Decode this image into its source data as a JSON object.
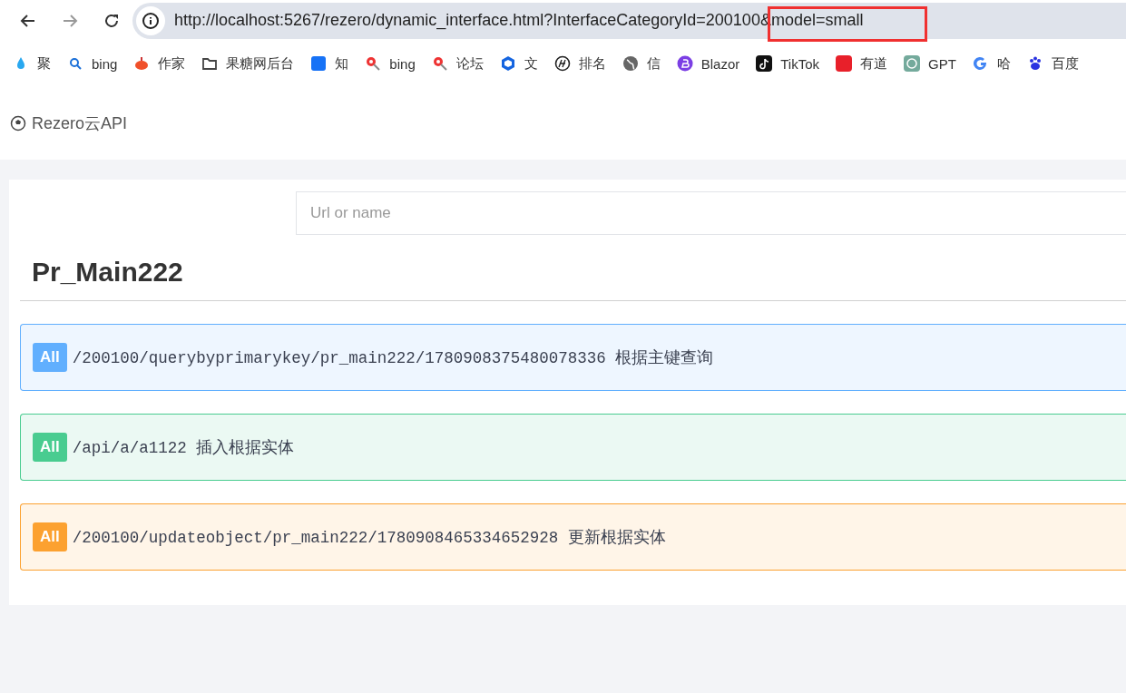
{
  "browser": {
    "url": "http://localhost:5267/rezero/dynamic_interface.html?InterfaceCategoryId=200100&model=small"
  },
  "bookmarks": [
    {
      "label": "聚"
    },
    {
      "label": "bing"
    },
    {
      "label": "作家"
    },
    {
      "label": "果糖网后台"
    },
    {
      "label": "知"
    },
    {
      "label": "bing"
    },
    {
      "label": "论坛"
    },
    {
      "label": "文"
    },
    {
      "label": "排名"
    },
    {
      "label": "信"
    },
    {
      "label": "Blazor"
    },
    {
      "label": "TikTok"
    },
    {
      "label": "有道"
    },
    {
      "label": "GPT"
    },
    {
      "label": "哈"
    },
    {
      "label": "百度"
    }
  ],
  "header": {
    "brand": "Rezero云API"
  },
  "search": {
    "placeholder": "Url or name"
  },
  "title": "Pr_Main222",
  "endpoints": [
    {
      "method": "All",
      "path": "/200100/querybyprimarykey/pr_main222/1780908375480078336 根据主键查询",
      "color": "#61affe"
    },
    {
      "method": "All",
      "path": "/api/a/a1122 插入根据实体",
      "color": "#49cc90"
    },
    {
      "method": "All",
      "path": "/200100/updateobject/pr_main222/1780908465334652928 更新根据实体",
      "color": "#fca130"
    }
  ]
}
